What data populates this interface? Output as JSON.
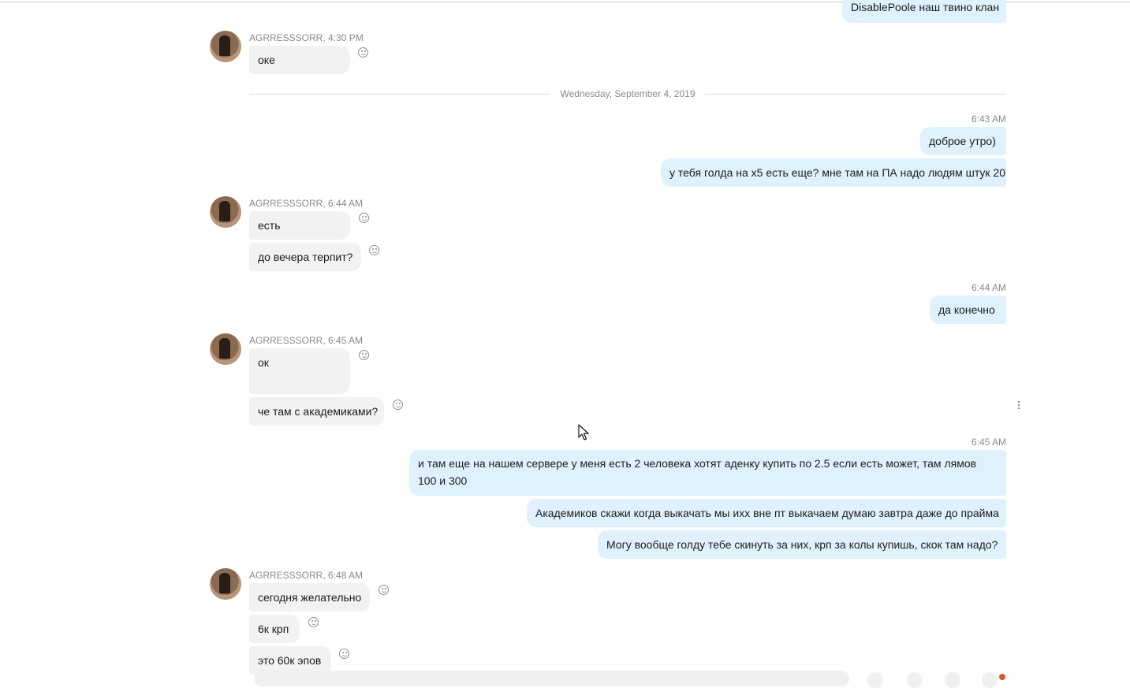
{
  "chat": {
    "top_message": "DisablePoole наш твино клан",
    "date_divider": "Wednesday, September 4, 2019",
    "groups": [
      {
        "meta": "AGRRESSSORR, 4:30 PM",
        "messages": [
          "оке"
        ]
      },
      {
        "meta": "6:43 AM",
        "messages": [
          "доброе утро)",
          "у тебя голда на х5 есть еще? мне там на ПА надо людям штук 20"
        ]
      },
      {
        "meta": "AGRRESSSORR, 6:44 AM",
        "messages": [
          "есть",
          "до вечера терпит?"
        ]
      },
      {
        "meta": "6:44 AM",
        "messages": [
          "да конечно"
        ]
      },
      {
        "meta": "AGRRESSSORR, 6:45 AM",
        "messages": [
          "ок",
          "че там с академиками?"
        ]
      },
      {
        "meta": "6:45 AM",
        "messages": [
          "и там еще на нашем сервере у меня есть 2 человека хотят аденку купить по 2.5 если есть может, там лямов 100 и 300",
          "Академиков скажи когда выкачать мы ихх вне пт выкачаем думаю завтра даже до прайма",
          "Могу вообще голду тебе скинуть за них, крп за колы купишь, скок там надо?"
        ]
      },
      {
        "meta": "AGRRESSSORR, 6:48 AM",
        "messages": [
          "сегодня желательно",
          "6к крп",
          "это 60к эпов"
        ]
      }
    ]
  },
  "icons": {
    "avatar": "user-avatar",
    "reaction": "smiley-icon",
    "menu": "more-vertical-icon",
    "cursor": "mouse-pointer"
  },
  "colors": {
    "incoming_bubble": "#f2f2f2",
    "outgoing_bubble": "#dff1fc"
  }
}
